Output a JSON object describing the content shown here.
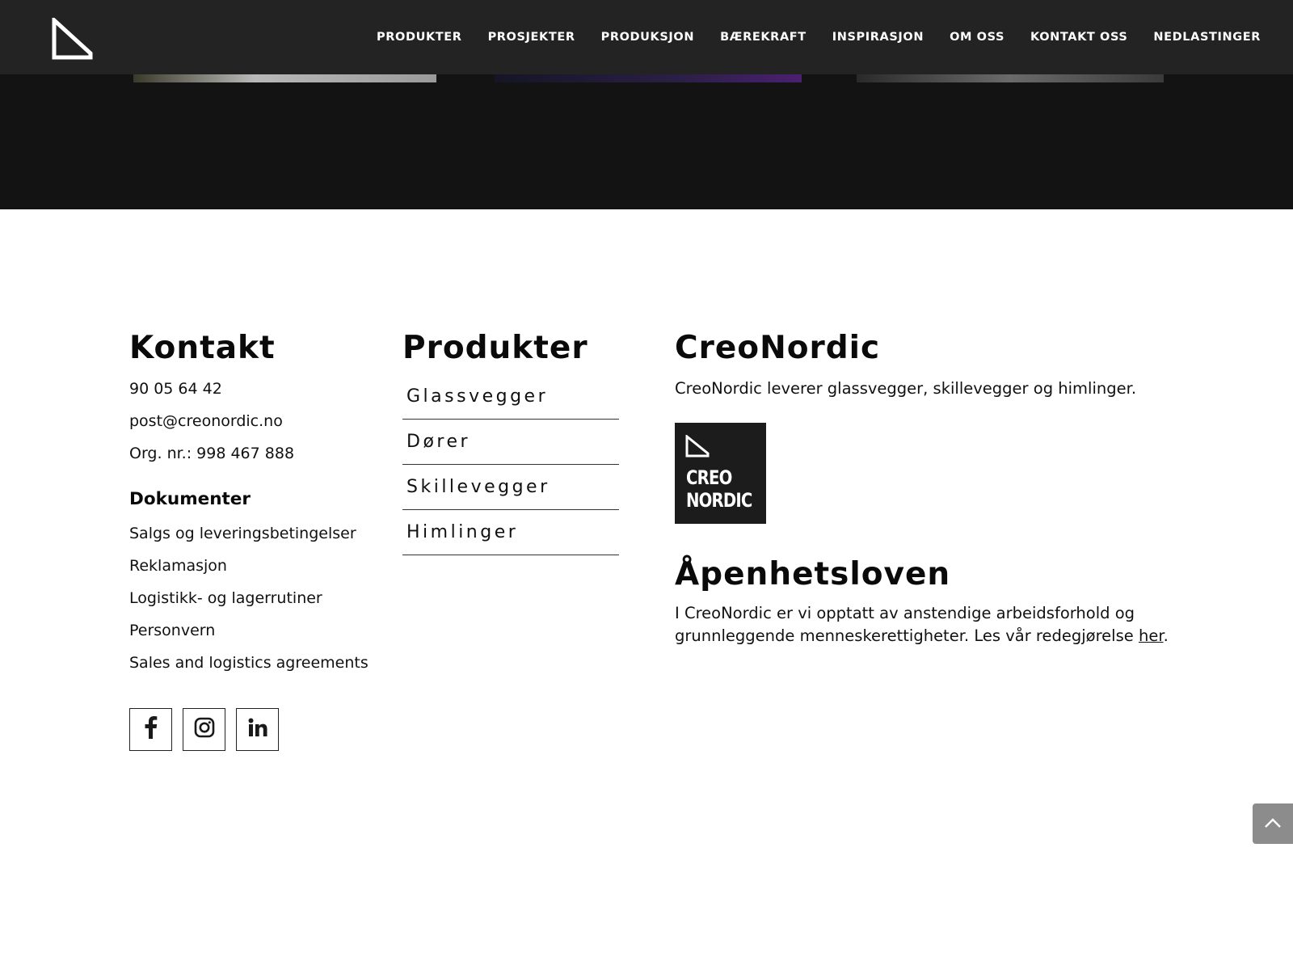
{
  "nav": {
    "items": [
      {
        "label": "PRODUKTER"
      },
      {
        "label": "PROSJEKTER"
      },
      {
        "label": "PRODUKSJON"
      },
      {
        "label": "BÆREKRAFT"
      },
      {
        "label": "INSPIRASJON"
      },
      {
        "label": "OM OSS"
      },
      {
        "label": "KONTAKT OSS"
      },
      {
        "label": "NEDLASTINGER"
      }
    ]
  },
  "kontakt": {
    "heading": "Kontakt",
    "phone": "90 05 64 42",
    "email": "post@creonordic.no",
    "org": "Org. nr.: 998 467 888",
    "documents_heading": "Dokumenter",
    "documents": [
      {
        "label": "Salgs og leveringsbetingelser"
      },
      {
        "label": "Reklamasjon"
      },
      {
        "label": "Logistikk- og lagerrutiner"
      },
      {
        "label": "Personvern"
      },
      {
        "label": "Sales and logistics agreements"
      }
    ],
    "socials": [
      {
        "icon": "facebook-icon"
      },
      {
        "icon": "instagram-icon"
      },
      {
        "icon": "linkedin-icon"
      }
    ]
  },
  "produkter": {
    "heading": "Produkter",
    "items": [
      {
        "label": "Glassvegger"
      },
      {
        "label": "Dører"
      },
      {
        "label": "Skillevegger"
      },
      {
        "label": "Himlinger"
      }
    ]
  },
  "creonordic": {
    "heading": "CreoNordic",
    "description": "CreoNordic leverer glassvegger, skillevegger og himlinger.",
    "logo_line1": "CREO",
    "logo_line2": "NORDIC"
  },
  "apenhet": {
    "heading": "Åpenhetsloven",
    "text": "I CreoNordic er vi opptatt av anstendige arbeidsforhold og grunnleggende menneskerettigheter. Les vår redegjørelse ",
    "link_label": "her",
    "suffix": "."
  },
  "colors": {
    "nav_bg": "#232323",
    "band_bg": "#131314",
    "back_to_top": "#8c8c8c"
  }
}
